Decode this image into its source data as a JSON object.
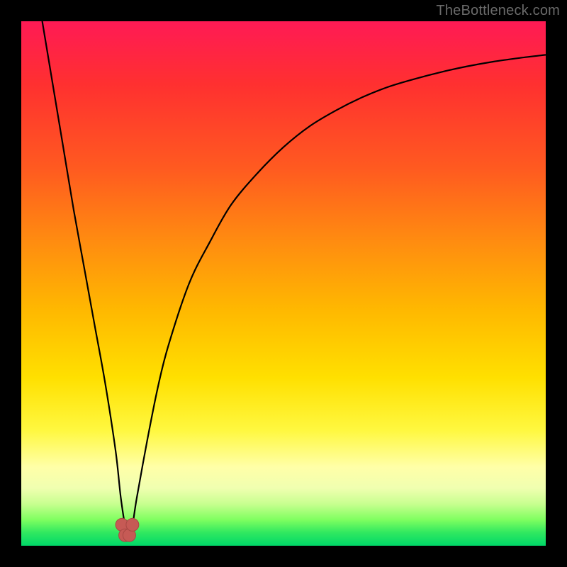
{
  "watermark": "TheBottleneck.com",
  "chart_data": {
    "type": "line",
    "title": "",
    "xlabel": "",
    "ylabel": "",
    "xlim": [
      0,
      100
    ],
    "ylim": [
      0,
      100
    ],
    "series": [
      {
        "name": "curve",
        "x": [
          4,
          6,
          8,
          10,
          12,
          14,
          16,
          18,
          19,
          20,
          21,
          22,
          24,
          26,
          28,
          32,
          36,
          40,
          45,
          50,
          55,
          60,
          65,
          70,
          75,
          80,
          85,
          90,
          95,
          100
        ],
        "values": [
          100,
          88,
          76,
          64,
          53,
          42,
          31,
          18,
          9,
          3,
          3,
          9,
          20,
          30,
          38,
          50,
          58,
          65,
          71,
          76,
          80,
          83,
          85.5,
          87.5,
          89,
          90.3,
          91.4,
          92.3,
          93,
          93.6
        ]
      }
    ],
    "markers": [
      {
        "name": "trough-left",
        "x": 19.2,
        "y": 4.0
      },
      {
        "name": "trough-mid-l",
        "x": 19.8,
        "y": 2.0
      },
      {
        "name": "trough-mid-r",
        "x": 20.6,
        "y": 2.0
      },
      {
        "name": "trough-right",
        "x": 21.2,
        "y": 4.0
      }
    ],
    "colors": {
      "curve": "#000000",
      "marker": "#c65a55",
      "top": "#ff1a55",
      "bottom": "#00d868"
    }
  }
}
